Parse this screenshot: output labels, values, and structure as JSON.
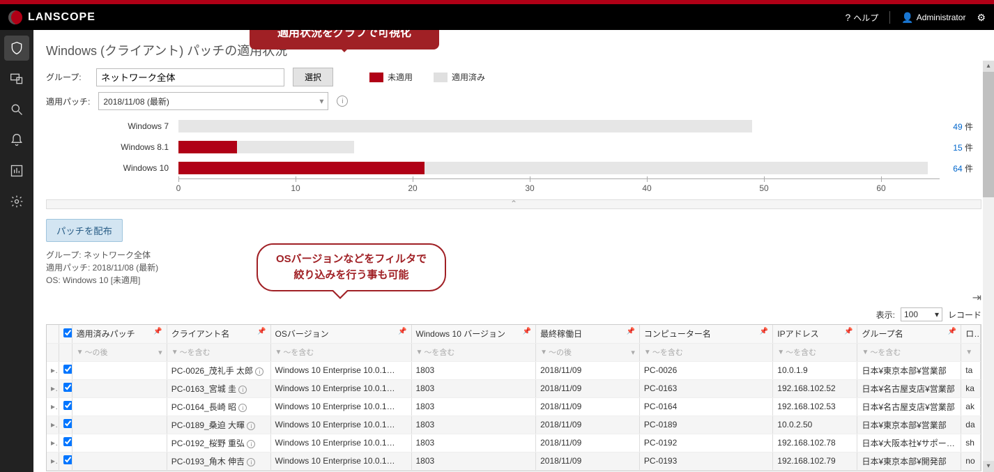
{
  "brand": "LANSCOPE",
  "header": {
    "help": "ヘルプ",
    "user": "Administrator"
  },
  "page_title": "Windows (クライアント) パッチの適用状況",
  "callout1": "適用状況をグラフで可視化",
  "callout2_l1": "OSバージョンなどをフィルタで",
  "callout2_l2": "絞り込みを行う事も可能",
  "filters": {
    "group_label": "グループ:",
    "group_value": "ネットワーク全体",
    "select_btn": "選択",
    "patch_label": "適用パッチ:",
    "patch_value": "2018/11/08 (最新)"
  },
  "legend": {
    "unapplied": "未適用",
    "applied": "適用済み"
  },
  "chart_data": {
    "type": "bar",
    "orientation": "horizontal",
    "stacked": true,
    "xlim": [
      0,
      65
    ],
    "xticks": [
      0,
      10,
      20,
      30,
      40,
      50,
      60
    ],
    "series_names": [
      "未適用",
      "適用済み"
    ],
    "categories": [
      "Windows 7",
      "Windows 8.1",
      "Windows 10"
    ],
    "series": [
      {
        "name": "未適用",
        "color": "#b00016",
        "values": [
          0,
          5,
          21
        ]
      },
      {
        "name": "適用済み",
        "color": "#e6e6e6",
        "values": [
          49,
          10,
          43
        ]
      }
    ],
    "totals": [
      49,
      15,
      64
    ],
    "count_suffix": "件"
  },
  "lower": {
    "distribute_btn": "パッチを配布",
    "info_group": "グループ: ネットワーク全体",
    "info_patch": "適用パッチ: 2018/11/08 (最新)",
    "info_os": "OS: Windows 10 [未適用]",
    "display_label": "表示:",
    "display_value": "100",
    "records_label": "レコード"
  },
  "columns": {
    "c1": "適用済みパッチ",
    "c2": "クライアント名",
    "c3": "OSバージョン",
    "c4": "Windows 10 バージョン",
    "c5": "最終稼働日",
    "c6": "コンピューター名",
    "c7": "IPアドレス",
    "c8": "グループ名",
    "c9": "ログオ"
  },
  "filter_ph": {
    "after": "～の後",
    "contains": "～を含む"
  },
  "rows": [
    {
      "client": "PC-0026_茂礼手 太郎",
      "os": "Windows 10 Enterprise 10.0.1…",
      "ver": "1803",
      "date": "2018/11/09",
      "comp": "PC-0026",
      "ip": "10.0.1.9",
      "grp": "日本¥東京本部¥営業部",
      "log": "ta"
    },
    {
      "client": "PC-0163_宮城 圭",
      "os": "Windows 10 Enterprise 10.0.1…",
      "ver": "1803",
      "date": "2018/11/09",
      "comp": "PC-0163",
      "ip": "192.168.102.52",
      "grp": "日本¥名古屋支店¥営業部",
      "log": "ka"
    },
    {
      "client": "PC-0164_長崎 昭",
      "os": "Windows 10 Enterprise 10.0.1…",
      "ver": "1803",
      "date": "2018/11/09",
      "comp": "PC-0164",
      "ip": "192.168.102.53",
      "grp": "日本¥名古屋支店¥営業部",
      "log": "ak"
    },
    {
      "client": "PC-0189_桑迫 大暉",
      "os": "Windows 10 Enterprise 10.0.1…",
      "ver": "1803",
      "date": "2018/11/09",
      "comp": "PC-0189",
      "ip": "10.0.2.50",
      "grp": "日本¥東京本部¥営業部",
      "log": "da"
    },
    {
      "client": "PC-0192_桜野 重弘",
      "os": "Windows 10 Enterprise 10.0.1…",
      "ver": "1803",
      "date": "2018/11/09",
      "comp": "PC-0192",
      "ip": "192.168.102.78",
      "grp": "日本¥大阪本社¥サポート部",
      "log": "sh"
    },
    {
      "client": "PC-0193_角木 伸吉",
      "os": "Windows 10 Enterprise 10.0.1…",
      "ver": "1803",
      "date": "2018/11/09",
      "comp": "PC-0193",
      "ip": "192.168.102.79",
      "grp": "日本¥東京本部¥開発部",
      "log": "no"
    }
  ]
}
